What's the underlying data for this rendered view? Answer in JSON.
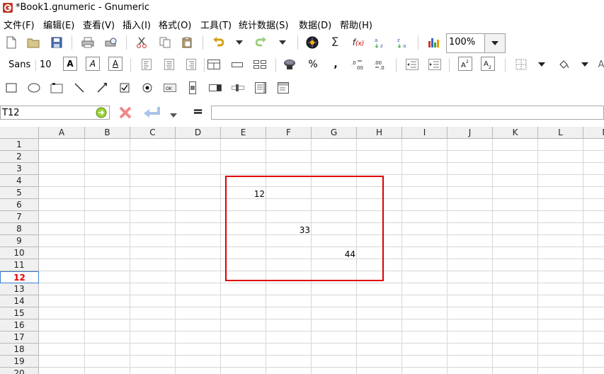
{
  "window": {
    "title": "*Book1.gnumeric - Gnumeric"
  },
  "menu": [
    {
      "label": "文件(F)"
    },
    {
      "label": "编辑(E)"
    },
    {
      "label": "查看(V)"
    },
    {
      "label": "插入(I)"
    },
    {
      "label": "格式(O)"
    },
    {
      "label": "工具(T)"
    },
    {
      "label": "统计数据(S)"
    },
    {
      "label": "数据(D)"
    },
    {
      "label": "帮助(H)"
    }
  ],
  "toolbar": {
    "zoom": "100%"
  },
  "format_toolbar": {
    "font_name": "Sans",
    "font_size": "10",
    "bold": "A",
    "italic": "A",
    "underline": "A",
    "percent": "%",
    "comma": ","
  },
  "formula_bar": {
    "cell_ref": "T12",
    "equals": "=",
    "formula": ""
  },
  "sheet": {
    "columns": [
      "A",
      "B",
      "C",
      "D",
      "E",
      "F",
      "G",
      "H",
      "I",
      "J",
      "K",
      "L",
      "M"
    ],
    "rows": [
      "1",
      "2",
      "3",
      "4",
      "5",
      "6",
      "7",
      "8",
      "9",
      "10",
      "11",
      "12",
      "13",
      "14",
      "15",
      "16",
      "17",
      "18",
      "19",
      "20"
    ],
    "active_row": "12",
    "cells": {
      "E5": "12",
      "F8": "33",
      "G10": "44"
    }
  },
  "colors": {
    "highlight": "#e00000",
    "active_row_text": "#e00000"
  }
}
